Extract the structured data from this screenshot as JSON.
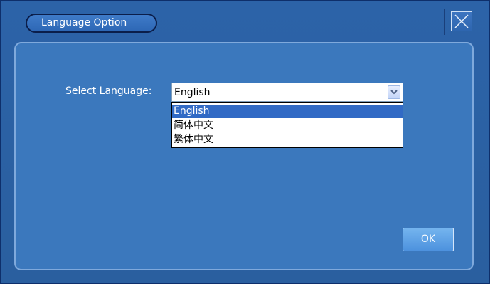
{
  "window": {
    "title": "Language Option",
    "close_icon": "close-icon"
  },
  "form": {
    "select_label": "Select Language:",
    "selected_value": "English",
    "dropdown_arrow_icon": "chevron-down-icon",
    "options": [
      {
        "label": "English",
        "highlighted": true
      },
      {
        "label": "简体中文",
        "highlighted": false
      },
      {
        "label": "繁体中文",
        "highlighted": false
      }
    ]
  },
  "buttons": {
    "ok_label": "OK"
  },
  "colors": {
    "window_bg": "#2c63a8",
    "panel_bg": "#3b78bd",
    "highlight": "#316ac5",
    "ok_button": "#5a9fe4"
  }
}
